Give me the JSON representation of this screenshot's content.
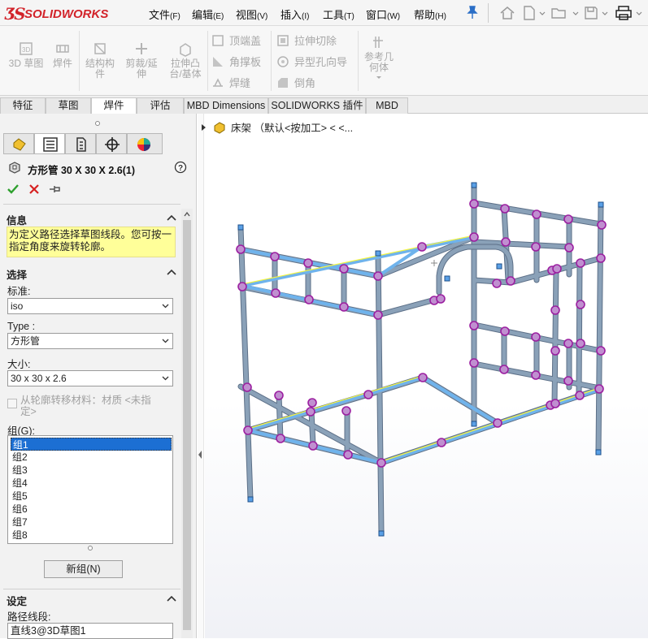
{
  "app": {
    "logo_text": "SOLIDWORKS"
  },
  "menu": [
    {
      "label": "文件",
      "accel": "(F)"
    },
    {
      "label": "编辑",
      "accel": "(E)"
    },
    {
      "label": "视图",
      "accel": "(V)"
    },
    {
      "label": "插入",
      "accel": "(I)"
    },
    {
      "label": "工具",
      "accel": "(T)"
    },
    {
      "label": "窗口",
      "accel": "(W)"
    },
    {
      "label": "帮助",
      "accel": "(H)"
    }
  ],
  "ribbon": {
    "sketch3d": "3D 草图",
    "weldment": "焊件",
    "structural_member": "结构构件",
    "trim_extend": "剪裁/延伸",
    "extruded_boss": "拉伸凸台/基体",
    "end_cap": "顶端盖",
    "gusset": "角撑板",
    "weld_bead": "焊缝",
    "extruded_cut": "拉伸切除",
    "hole_wizard": "异型孔向导",
    "chamfer": "倒角",
    "ref_geometry": "参考几何体"
  },
  "tabs": [
    "特征",
    "草图",
    "焊件",
    "评估",
    "MBD Dimensions",
    "SOLIDWORKS 插件",
    "MBD"
  ],
  "active_tab": "焊件",
  "panel": {
    "title": "方形管 30 X 30 X 2.6(1)",
    "info_head": "信息",
    "info_text": "为定义路径选择草图线段。您可按一指定角度来旋转轮廓。",
    "select_head": "选择",
    "standard_label": "标准:",
    "standard_value": "iso",
    "type_label": "Type :",
    "type_value": "方形管",
    "size_label": "大小:",
    "size_value": "30 x 30 x 2.6",
    "transfer_material": "从轮廓转移材料：材质 <未指定>",
    "group_label": "组(G):",
    "groups": [
      "组1",
      "组2",
      "组3",
      "组4",
      "组5",
      "组6",
      "组7",
      "组8"
    ],
    "selected_group": "组1",
    "new_group": "新组(N)",
    "settings_head": "设定",
    "path_label": "路径线段:",
    "path_value": "直线3@3D草图1"
  },
  "tree": {
    "part_label": "床架 （默认<按加工> < <..."
  },
  "colors": {
    "brand_red": "#d2232a",
    "member_blue": "#8aa1b8",
    "edge_yellow": "#f5f542",
    "node_magenta": "#9b1fa0",
    "select_blue": "#1c6fd3",
    "info_yellow": "#ffff99"
  }
}
